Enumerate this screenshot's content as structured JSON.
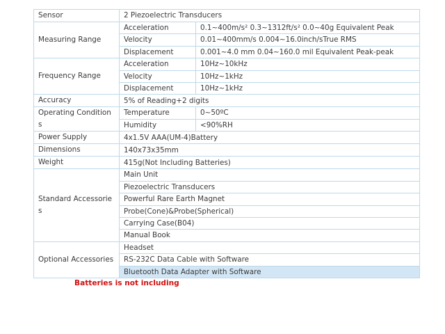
{
  "spec_table": {
    "sensor": {
      "label": "Sensor",
      "value": "2 Piezoelectric Transducers"
    },
    "measuring_range": {
      "label": "Measuring Range",
      "rows": [
        {
          "param": "Acceleration",
          "value": "0.1~400m/s² 0.3~1312ft/s² 0.0~40g Equivalent Peak"
        },
        {
          "param": "Velocity",
          "value": "0.01~400mm/s 0.004~16.0inch/sTrue RMS"
        },
        {
          "param": "Displacement",
          "value": "0.001~4.0 mm 0.04~160.0 mil Equivalent Peak-peak"
        }
      ]
    },
    "frequency_range": {
      "label": "Frequency Range",
      "rows": [
        {
          "param": "Acceleration",
          "value": "10Hz~10kHz"
        },
        {
          "param": "Velocity",
          "value": "10Hz~1kHz"
        },
        {
          "param": "Displacement",
          "value": "10Hz~1kHz"
        }
      ]
    },
    "accuracy": {
      "label": "Accuracy",
      "value": "5% of Reading+2 digits"
    },
    "operating_condition": {
      "label": "Operating Condition s",
      "rows": [
        {
          "param": "Temperature",
          "value": "0~50ºC"
        },
        {
          "param": "Humidity",
          "value": "<90%RH"
        }
      ]
    },
    "power_supply": {
      "label": "Power Supply",
      "value": "4x1.5V AAA(UM-4)Battery"
    },
    "dimensions": {
      "label": "Dimensions",
      "value": "140x73x35mm"
    },
    "weight": {
      "label": "Weight",
      "value": "415g(Not Including Batteries)"
    },
    "standard_accessories": {
      "label": "Standard Accessorie s",
      "items": [
        "Main Unit",
        "Piezoelectric Transducers",
        "Powerful Rare Earth Magnet",
        "Probe(Cone)&Probe(Spherical)",
        "Carrying Case(B04)",
        "Manual Book"
      ]
    },
    "optional_accessories": {
      "label": "Optional Accessories",
      "items": [
        "Headset",
        "RS-232C Data Cable with Software",
        "Bluetooth Data Adapter with Software"
      ]
    }
  },
  "note": "Batteries is not including",
  "colors": {
    "border": "#bcd9ea",
    "highlight": "#d2e6f5",
    "note": "#d01010"
  }
}
